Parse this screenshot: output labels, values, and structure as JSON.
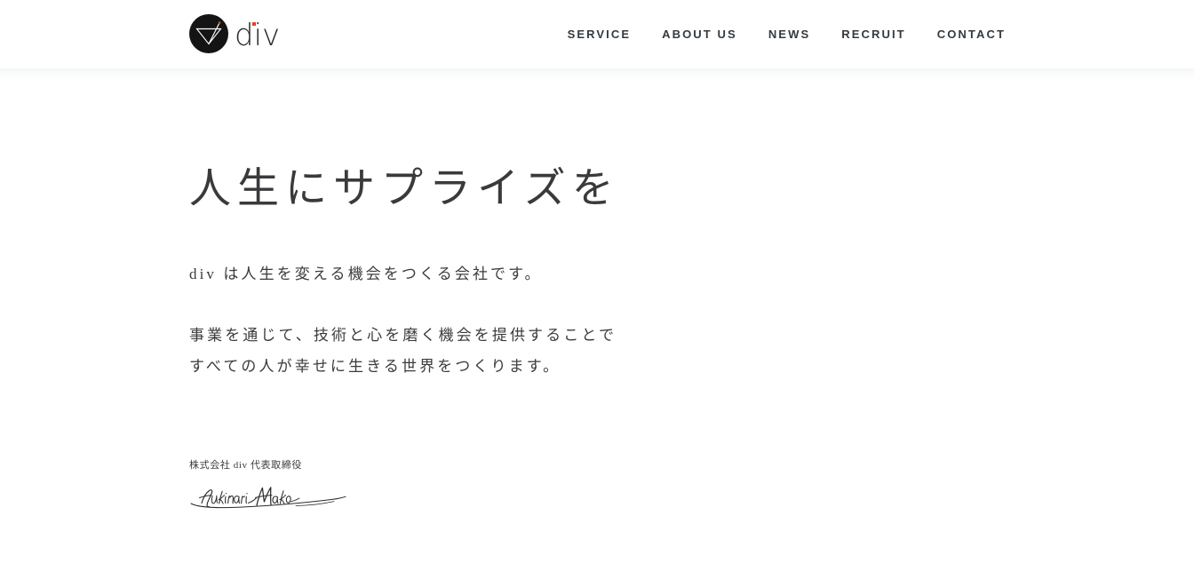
{
  "brand": {
    "logo_mark_name": "div-triangle-logo",
    "wordmark": "div",
    "accent_color": "#e8402a",
    "mark_color": "#141414"
  },
  "nav": {
    "items": [
      {
        "label": "SERVICE"
      },
      {
        "label": "ABOUT US"
      },
      {
        "label": "NEWS"
      },
      {
        "label": "RECRUIT"
      },
      {
        "label": "CONTACT"
      }
    ]
  },
  "hero": {
    "title": "人生にサプライズを",
    "lead": "div は人生を変える機会をつくる会社です。",
    "body_line1": "事業を通じて、技術と心を磨く機会を提供することで",
    "body_line2": "すべての人が幸せに生きる世界をつくります。"
  },
  "signature": {
    "caption": "株式会社 div  代表取締役",
    "signature_name": "ceo-handwritten-signature"
  },
  "colors": {
    "page_background": "#ffffff",
    "heading_text": "#3a3a3c",
    "body_text": "#3b3b3d",
    "nav_text": "#333a40",
    "header_divider": "#f5f6f7"
  }
}
